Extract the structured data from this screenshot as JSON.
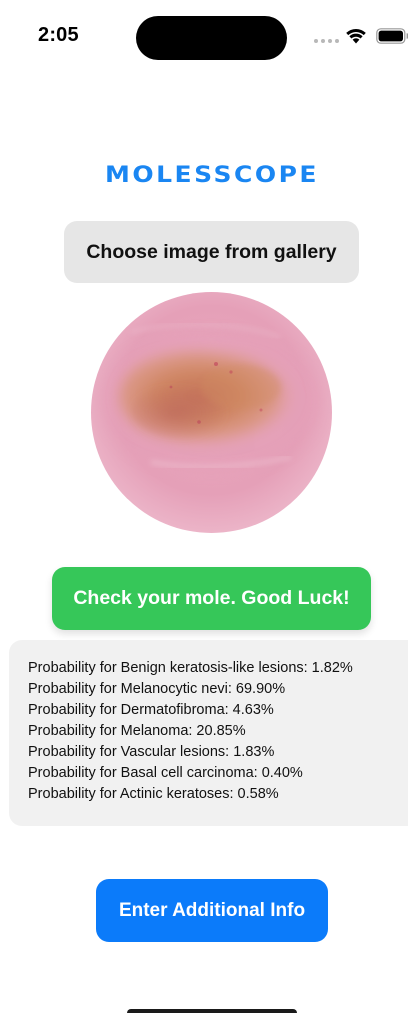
{
  "status_bar": {
    "time": "2:05"
  },
  "app": {
    "title": "MOLESSCOPE"
  },
  "actions": {
    "gallery_label": "Choose image from gallery",
    "check_label": "Check your mole. Good Luck!",
    "info_label": "Enter Additional Info"
  },
  "results": [
    {
      "label": "Probability for Benign keratosis-like lesions: 1.82%"
    },
    {
      "label": "Probability for Melanocytic nevi: 69.90%"
    },
    {
      "label": "Probability for Dermatofibroma: 4.63%"
    },
    {
      "label": "Probability for Melanoma: 20.85%"
    },
    {
      "label": "Probability for Vascular lesions: 1.83%"
    },
    {
      "label": "Probability for Basal cell carcinoma: 0.40%"
    },
    {
      "label": "Probability for Actinic keratoses: 0.58%"
    }
  ],
  "icons": {
    "status": [
      "signal-dots-icon",
      "wifi-icon",
      "battery-icon"
    ]
  },
  "colors": {
    "title_blue": "#1a86f2",
    "gallery_gray": "#e6e6e6",
    "check_green": "#36c759",
    "panel_gray": "#f1f1f1",
    "info_blue": "#0b7bfa"
  }
}
